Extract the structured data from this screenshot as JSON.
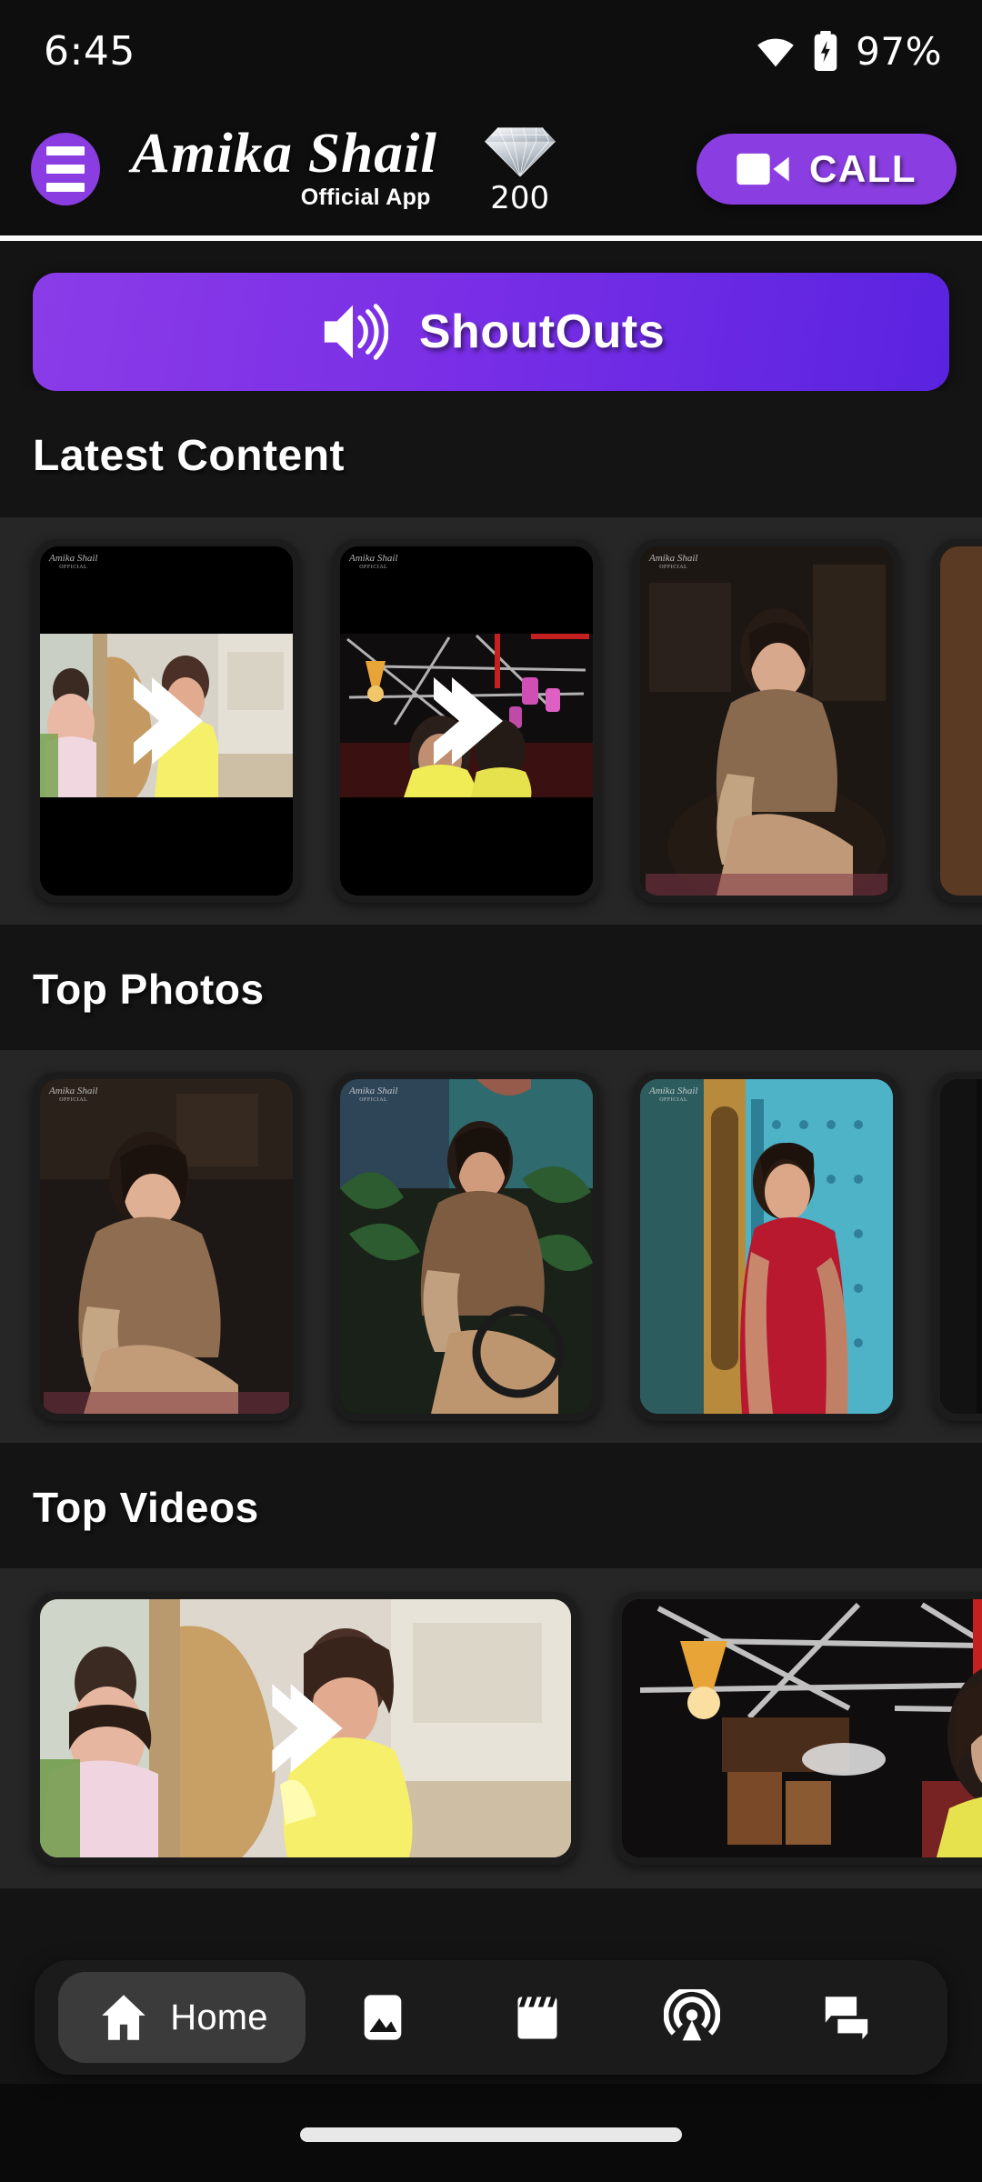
{
  "status_bar": {
    "time": "6:45",
    "battery_percent": "97%",
    "wifi_icon": "wifi-icon",
    "battery_icon": "battery-charging-icon"
  },
  "header": {
    "menu_icon": "hamburger-menu-icon",
    "brand_name": "Amika Shail",
    "brand_subtitle": "Official App",
    "gem_icon": "diamond-icon",
    "gem_count": "200",
    "call_icon": "video-camera-icon",
    "call_label": "CALL",
    "accent_color": "#8a3de0"
  },
  "shoutouts": {
    "label": "ShoutOuts",
    "icon": "speaker-volume-icon",
    "gradient_from": "#8b3ce8",
    "gradient_to": "#5a23e0"
  },
  "sections": [
    {
      "id": "latest-content",
      "title": "Latest Content",
      "items": [
        {
          "type": "video",
          "watermark": "Amika Shail",
          "watermark_sub": "OFFICIAL",
          "play_icon": "play-arrow-icon"
        },
        {
          "type": "video",
          "watermark": "Amika Shail",
          "watermark_sub": "OFFICIAL",
          "play_icon": "play-arrow-icon"
        },
        {
          "type": "photo",
          "watermark": "Amika Shail",
          "watermark_sub": "OFFICIAL"
        },
        {
          "type": "photo",
          "watermark": "",
          "watermark_sub": ""
        }
      ]
    },
    {
      "id": "top-photos",
      "title": "Top Photos",
      "items": [
        {
          "type": "photo",
          "watermark": "Amika Shail",
          "watermark_sub": "OFFICIAL"
        },
        {
          "type": "photo",
          "watermark": "Amika Shail",
          "watermark_sub": "OFFICIAL"
        },
        {
          "type": "photo",
          "watermark": "Amika Shail",
          "watermark_sub": "OFFICIAL"
        },
        {
          "type": "photo",
          "watermark": "",
          "watermark_sub": ""
        }
      ]
    },
    {
      "id": "top-videos",
      "title": "Top Videos",
      "items": [
        {
          "type": "video",
          "play_icon": "play-arrow-icon"
        },
        {
          "type": "video",
          "play_icon": "play-arrow-icon"
        }
      ]
    }
  ],
  "bottom_nav": {
    "items": [
      {
        "id": "home",
        "label": "Home",
        "icon": "home-icon",
        "active": true
      },
      {
        "id": "photos",
        "label": "",
        "icon": "gallery-icon",
        "active": false
      },
      {
        "id": "videos",
        "label": "",
        "icon": "clapperboard-icon",
        "active": false
      },
      {
        "id": "live",
        "label": "",
        "icon": "broadcast-live-icon",
        "active": false
      },
      {
        "id": "chat",
        "label": "",
        "icon": "forum-chat-icon",
        "active": false
      }
    ]
  }
}
